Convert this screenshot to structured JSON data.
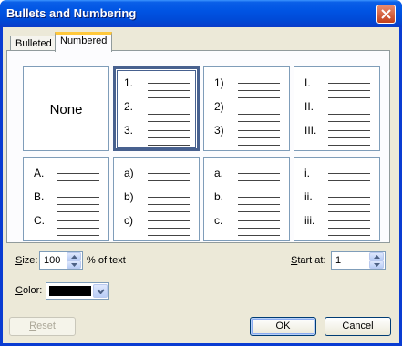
{
  "window": {
    "title": "Bullets and Numbering"
  },
  "tabs": [
    {
      "label": "Bulleted"
    },
    {
      "label": "Numbered"
    }
  ],
  "styles": [
    {
      "label": "None"
    },
    {
      "items": [
        "1.",
        "2.",
        "3."
      ]
    },
    {
      "items": [
        "1)",
        "2)",
        "3)"
      ]
    },
    {
      "items": [
        "I.",
        "II.",
        "III."
      ]
    },
    {
      "items": [
        "A.",
        "B.",
        "C."
      ]
    },
    {
      "items": [
        "a)",
        "b)",
        "c)"
      ]
    },
    {
      "items": [
        "a.",
        "b.",
        "c."
      ]
    },
    {
      "items": [
        "i.",
        "ii.",
        "iii."
      ]
    }
  ],
  "selected_style": 1,
  "size": {
    "label_mnemonic": "S",
    "label_rest": "ize:",
    "value": "100",
    "suffix": "% of text"
  },
  "start_at": {
    "label_mnemonic": "S",
    "label_rest": "tart at:",
    "value": "1"
  },
  "color": {
    "label_mnemonic": "C",
    "label_rest": "olor:",
    "value": "#000000"
  },
  "buttons": {
    "reset_mnemonic": "R",
    "reset_rest": "eset",
    "ok": "OK",
    "cancel": "Cancel"
  }
}
